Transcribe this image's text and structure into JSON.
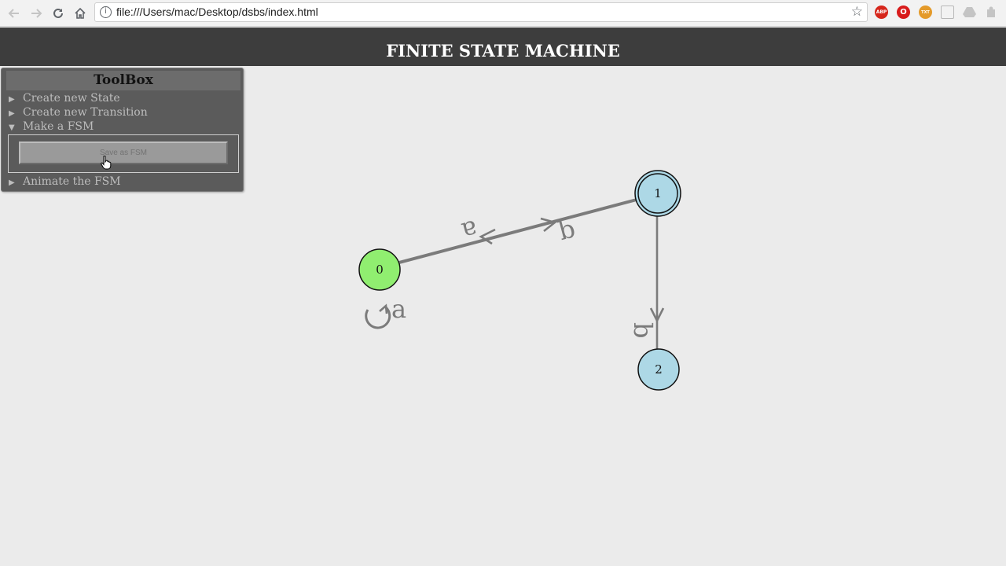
{
  "browser": {
    "url": "file:///Users/mac/Desktop/dsbs/index.html",
    "back_icon": "arrow-left-icon",
    "forward_icon": "arrow-right-icon",
    "reload_icon": "reload-icon",
    "home_icon": "home-icon",
    "info_icon": "info-icon",
    "bookmark_icon": "star-icon",
    "extensions": [
      {
        "name": "adblock-icon",
        "label": "ABP",
        "color": "#d6261b"
      },
      {
        "name": "opera-icon",
        "label": "O",
        "color": "#d81b1b"
      },
      {
        "name": "text-extension-icon",
        "label": "TXT",
        "color": "#e49a2a"
      },
      {
        "name": "edit-extension-icon",
        "label": "",
        "color": "#b8b8b8"
      },
      {
        "name": "drive-icon",
        "label": "",
        "color": "#b8b8b8"
      },
      {
        "name": "puzzle-icon",
        "label": "",
        "color": "#b8b8b8"
      }
    ]
  },
  "app": {
    "title": "FINITE STATE MACHINE",
    "header_color": "#3d3d3d"
  },
  "toolbox": {
    "title": "ToolBox",
    "items": [
      {
        "label": "Create new State",
        "expanded": false
      },
      {
        "label": "Create new Transition",
        "expanded": false
      },
      {
        "label": "Make a FSM",
        "expanded": true
      },
      {
        "label": "Animate the FSM",
        "expanded": false
      }
    ],
    "save_button": "Save as FSM"
  },
  "fsm": {
    "states": [
      {
        "id": "0",
        "label": "0",
        "color": "#90ee70",
        "accepting": false,
        "start": true
      },
      {
        "id": "1",
        "label": "1",
        "color": "#add8e6",
        "accepting": true,
        "start": false
      },
      {
        "id": "2",
        "label": "2",
        "color": "#add8e6",
        "accepting": false,
        "start": false
      }
    ],
    "transitions": [
      {
        "from": "0",
        "to": "0",
        "symbol": "a"
      },
      {
        "from": "1",
        "to": "0",
        "symbol": "a"
      },
      {
        "from": "0",
        "to": "1",
        "symbol": "b"
      },
      {
        "from": "1",
        "to": "2",
        "symbol": "b"
      }
    ],
    "edge_color": "#7b7b7b"
  }
}
